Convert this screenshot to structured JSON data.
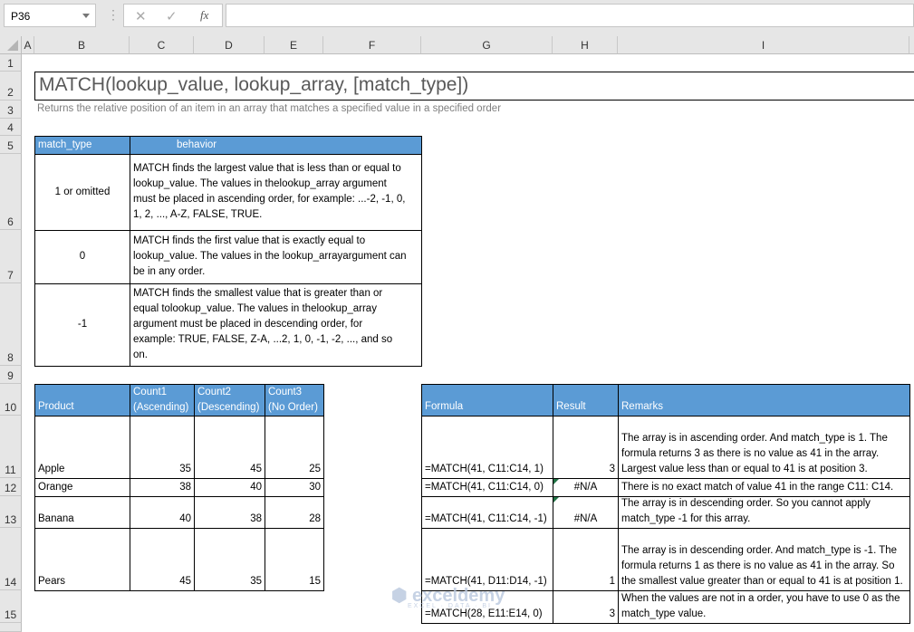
{
  "formula_bar": {
    "name_box": "P36",
    "cancel_icon": "✕",
    "enter_icon": "✓",
    "fx_label": "fx",
    "formula": ""
  },
  "columns": [
    "A",
    "B",
    "C",
    "D",
    "E",
    "F",
    "G",
    "H",
    "I"
  ],
  "rows": [
    "1",
    "2",
    "3",
    "4",
    "5",
    "6",
    "7",
    "8",
    "9",
    "10",
    "11",
    "12",
    "13",
    "14",
    "15"
  ],
  "title": "MATCH(lookup_value, lookup_array, [match_type])",
  "subtitle": "Returns the relative position of an item in an array that matches a specified value in a specified order",
  "behavior_table": {
    "headers": [
      "match_type",
      "behavior"
    ],
    "rows": [
      {
        "type": "1 or omitted",
        "behavior": "MATCH finds the largest value that is less than or equal to lookup_value. The values in thelookup_array argument must be placed in ascending order, for example: ...-2, -1, 0, 1, 2, ..., A-Z, FALSE, TRUE."
      },
      {
        "type": "0",
        "behavior": "MATCH finds the first value that is exactly equal to lookup_value. The values in the lookup_arrayargument can be in any order."
      },
      {
        "type": "-1",
        "behavior": "MATCH finds the smallest value that is greater than or equal tolookup_value. The values in thelookup_array argument must be placed in descending order, for example: TRUE, FALSE, Z-A, ...2, 1, 0, -1, -2, ..., and so on."
      }
    ]
  },
  "product_table": {
    "headers": [
      "Product",
      "Count1 (Ascending)",
      "Count2 (Descending)",
      "Count3 (No Order)"
    ],
    "rows": [
      [
        "Apple",
        "35",
        "45",
        "25"
      ],
      [
        "Orange",
        "38",
        "40",
        "30"
      ],
      [
        "Banana",
        "40",
        "38",
        "28"
      ],
      [
        "Pears",
        "45",
        "35",
        "15"
      ]
    ]
  },
  "formula_table": {
    "headers": [
      "Formula",
      "Result",
      "Remarks"
    ],
    "rows": [
      [
        "=MATCH(41, C11:C14, 1)",
        "3",
        "The array is in ascending order. And match_type is 1. The formula returns 3 as there is no value as 41 in the array. Largest value less than or equal to 41 is at position 3."
      ],
      [
        "=MATCH(41, C11:C14, 0)",
        "#N/A",
        "There is no exact match of value 41 in the range C11: C14."
      ],
      [
        "=MATCH(41, C11:C14, -1)",
        "#N/A",
        "The array is in descending order. So you cannot apply match_type -1 for this array."
      ],
      [
        "=MATCH(41, D11:D14, -1)",
        "1",
        "The array is in descending order. And match_type is -1. The formula returns 1 as there is no value as 41 in the array. So the smallest value greater than or equal to 41 is at position 1."
      ],
      [
        "=MATCH(28, E11:E14, 0)",
        "3",
        "When the values are not in a order, you have to use 0 as the match_type value."
      ]
    ]
  },
  "watermark": {
    "name": "exceldemy",
    "tagline": "EXCEL · DATA · BI"
  },
  "colors": {
    "header_fill": "#5b9bd5",
    "error_indicator": "#217346"
  }
}
